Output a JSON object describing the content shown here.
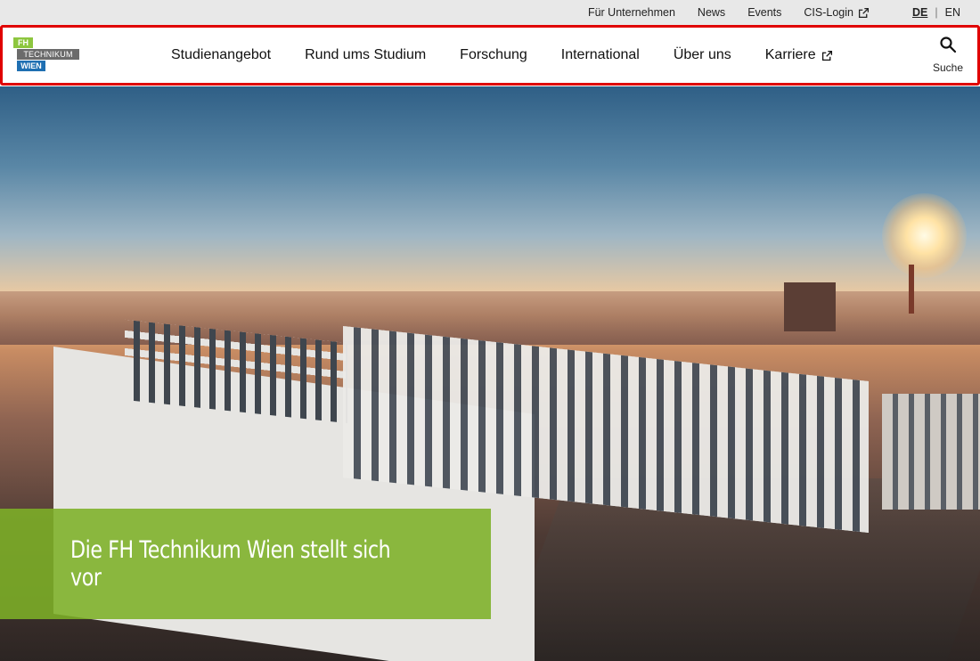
{
  "topbar": {
    "links": [
      "Für Unternehmen",
      "News",
      "Events",
      "CIS-Login"
    ],
    "languages": {
      "active": "DE",
      "other": "EN",
      "separator": "|"
    }
  },
  "logo": {
    "line1": "FH",
    "line2": "TECHNIKUM",
    "line3": "WIEN"
  },
  "nav": {
    "items": [
      "Studienangebot",
      "Rund ums Studium",
      "Forschung",
      "International",
      "Über uns",
      "Karriere"
    ]
  },
  "search": {
    "label": "Suche",
    "icon": "search-icon"
  },
  "hero": {
    "teaser_title": "Die FH Technikum Wien stellt sich vor",
    "teaser_color": "#7db027"
  },
  "colors": {
    "highlight_border": "#e00000",
    "brand_green": "#8dc63f",
    "brand_blue": "#1f6fb2"
  }
}
